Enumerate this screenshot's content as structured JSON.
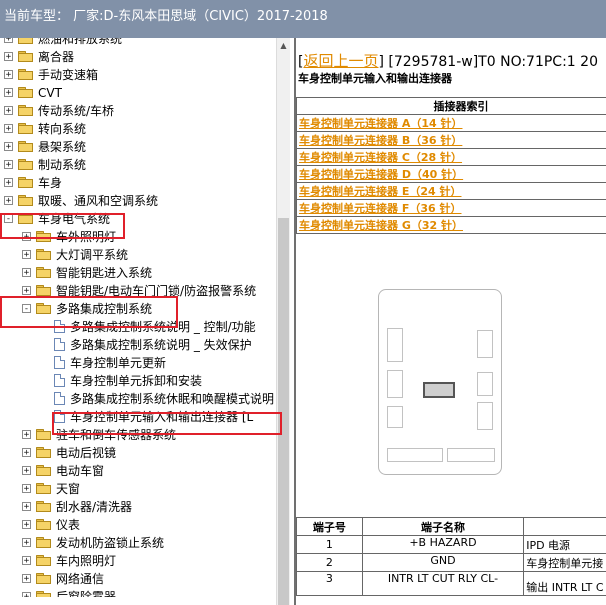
{
  "window": {
    "title": "当前车型： 厂家:D-东风本田思域（CIVIC）2017-2018"
  },
  "tree": {
    "items": [
      {
        "label": "燃油和排放系统",
        "level": 1,
        "type": "folder",
        "expander": "+"
      },
      {
        "label": "离合器",
        "level": 1,
        "type": "folder",
        "expander": "+"
      },
      {
        "label": "手动变速箱",
        "level": 1,
        "type": "folder",
        "expander": "+"
      },
      {
        "label": "CVT",
        "level": 1,
        "type": "folder",
        "expander": "+"
      },
      {
        "label": "传动系统/车桥",
        "level": 1,
        "type": "folder",
        "expander": "+"
      },
      {
        "label": "转向系统",
        "level": 1,
        "type": "folder",
        "expander": "+"
      },
      {
        "label": "悬架系统",
        "level": 1,
        "type": "folder",
        "expander": "+"
      },
      {
        "label": "制动系统",
        "level": 1,
        "type": "folder",
        "expander": "+"
      },
      {
        "label": "车身",
        "level": 1,
        "type": "folder",
        "expander": "+"
      },
      {
        "label": "取暖、通风和空调系统",
        "level": 1,
        "type": "folder",
        "expander": "+"
      },
      {
        "label": "车身电气系统",
        "level": 1,
        "type": "folder",
        "expander": "-"
      },
      {
        "label": "车外照明灯",
        "level": 2,
        "type": "folder",
        "expander": "+"
      },
      {
        "label": "大灯调平系统",
        "level": 2,
        "type": "folder",
        "expander": "+"
      },
      {
        "label": "智能钥匙进入系统",
        "level": 2,
        "type": "folder",
        "expander": "+"
      },
      {
        "label": "智能钥匙/电动车门门锁/防盗报警系统",
        "level": 2,
        "type": "folder",
        "expander": "+"
      },
      {
        "label": "多路集成控制系统",
        "level": 2,
        "type": "folder",
        "expander": "-"
      },
      {
        "label": "多路集成控制系统说明 _ 控制/功能",
        "level": 3,
        "type": "doc",
        "expander": ""
      },
      {
        "label": "多路集成控制系统说明 _ 失效保护",
        "level": 3,
        "type": "doc",
        "expander": ""
      },
      {
        "label": "车身控制单元更新",
        "level": 3,
        "type": "doc",
        "expander": ""
      },
      {
        "label": "车身控制单元拆卸和安装",
        "level": 3,
        "type": "doc",
        "expander": ""
      },
      {
        "label": "多路集成控制系统休眠和唤醒模式说明",
        "level": 3,
        "type": "doc",
        "expander": ""
      },
      {
        "label": "车身控制单元输入和输出连接器 [L",
        "level": 3,
        "type": "doc",
        "expander": ""
      },
      {
        "label": "驻车和倒车传感器系统",
        "level": 2,
        "type": "folder",
        "expander": "+"
      },
      {
        "label": "电动后视镜",
        "level": 2,
        "type": "folder",
        "expander": "+"
      },
      {
        "label": "电动车窗",
        "level": 2,
        "type": "folder",
        "expander": "+"
      },
      {
        "label": "天窗",
        "level": 2,
        "type": "folder",
        "expander": "+"
      },
      {
        "label": "刮水器/清洗器",
        "level": 2,
        "type": "folder",
        "expander": "+"
      },
      {
        "label": "仪表",
        "level": 2,
        "type": "folder",
        "expander": "+"
      },
      {
        "label": "发动机防盗锁止系统",
        "level": 2,
        "type": "folder",
        "expander": "+"
      },
      {
        "label": "车内照明灯",
        "level": 2,
        "type": "folder",
        "expander": "+"
      },
      {
        "label": "网络通信",
        "level": 2,
        "type": "folder",
        "expander": "+"
      },
      {
        "label": "后窗除雾器",
        "level": 2,
        "type": "folder",
        "expander": "+"
      }
    ]
  },
  "content": {
    "back_link": "返回上一页",
    "doc_code": "[7295781-w]T0 NO:71PC:1 20",
    "subtitle": "车身控制单元输入和输出连接器",
    "connector_table": {
      "header": "插接器索引",
      "rows": [
        "车身控制单元连接器 A（14 针）",
        "车身控制单元连接器 B（36 针）",
        "车身控制单元连接器 C（28 针）",
        "车身控制单元连接器 D（40 针）",
        "车身控制单元连接器 E（24 针）",
        "车身控制单元连接器 F（36 针）",
        "车身控制单元连接器 G（32 针）"
      ]
    },
    "terminal_table": {
      "headers": [
        "端子号",
        "端子名称",
        ""
      ],
      "rows": [
        [
          "1",
          "+B HAZARD",
          "IPD 电源"
        ],
        [
          "2",
          "GND",
          "车身控制单元接"
        ],
        [
          "3",
          "INTR LT CUT RLY CL-",
          "输出 INTR LT C"
        ]
      ]
    }
  },
  "colors": {
    "titlebar_bg": "#8191a8",
    "link": "#e08a00",
    "highlight_box": "#e0202a"
  }
}
